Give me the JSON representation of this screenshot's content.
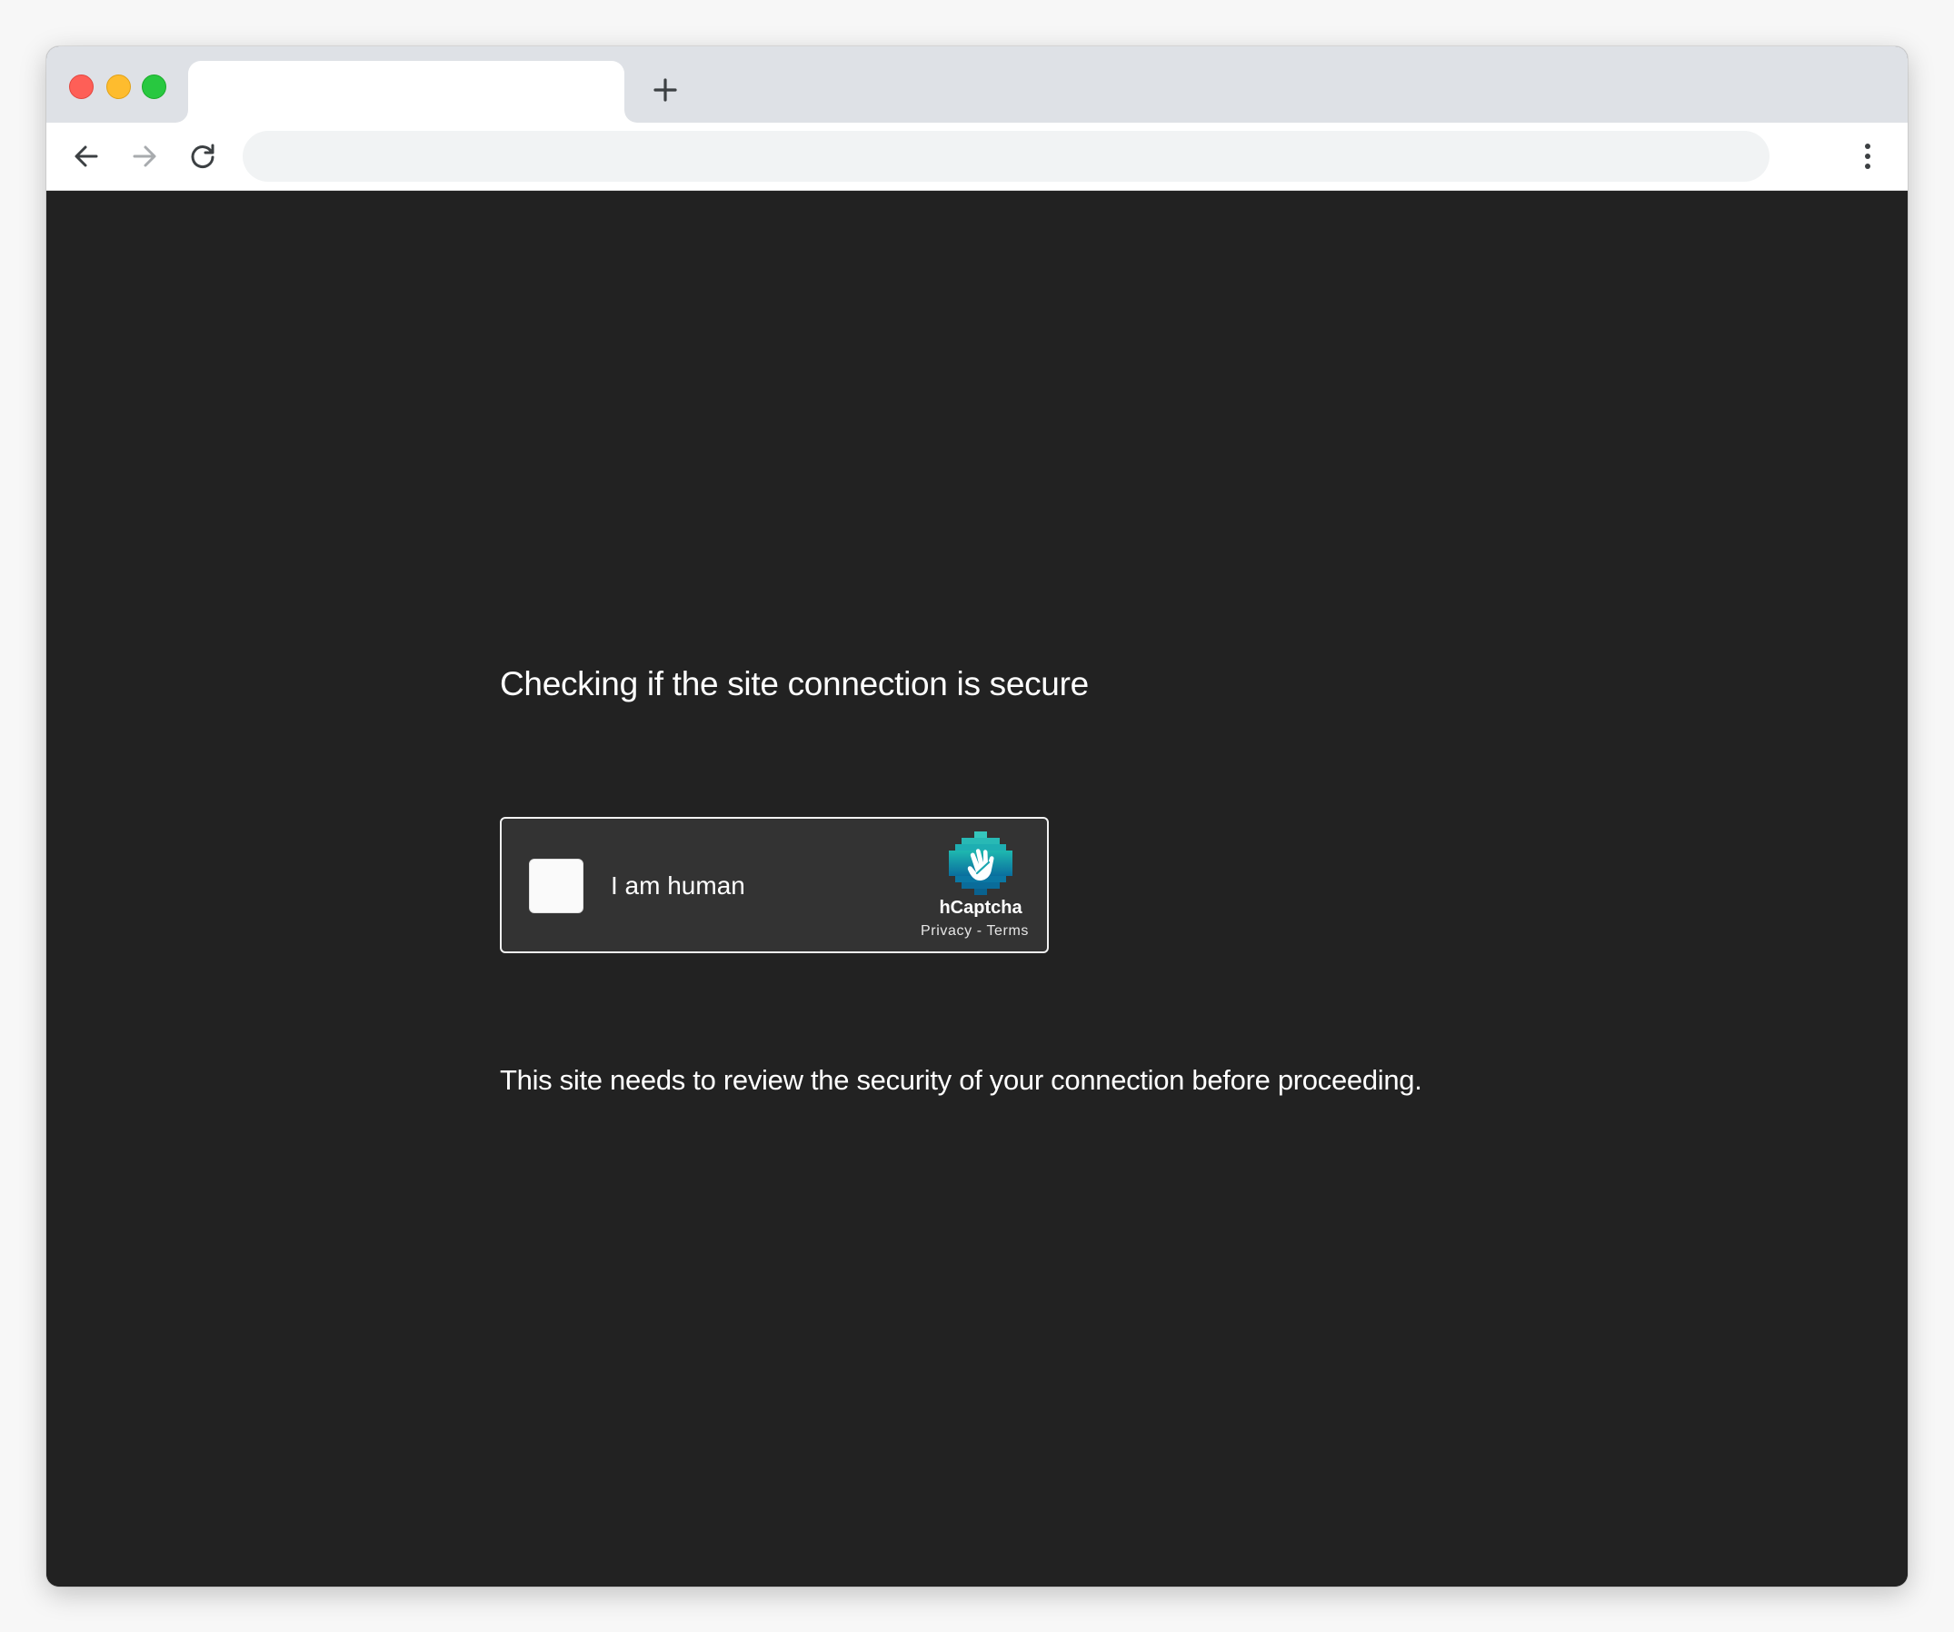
{
  "browser": {
    "tab_title": "",
    "new_tab_icon": "plus-icon",
    "address": "",
    "icons": {
      "back": "arrow-left-icon",
      "forward": "arrow-right-icon",
      "reload": "reload-icon",
      "menu": "kebab-menu-icon"
    },
    "colors": {
      "tab_strip": "#dee1e6",
      "toolbar": "#ffffff",
      "omnibox": "#f1f3f4",
      "traffic_red": "#fe5f57",
      "traffic_yellow": "#febc2e",
      "traffic_green": "#28c840"
    }
  },
  "page": {
    "heading": "Checking if the site connection is secure",
    "description": "This site needs to review the security of your connection before proceeding.",
    "background": "#222222"
  },
  "captcha": {
    "checkbox_label": "I am human",
    "checked": false,
    "brand": "hCaptcha",
    "brand_icon": "hcaptcha-logo-icon",
    "privacy_link": "Privacy",
    "separator": "-",
    "terms_link": "Terms",
    "background": "#333333"
  }
}
